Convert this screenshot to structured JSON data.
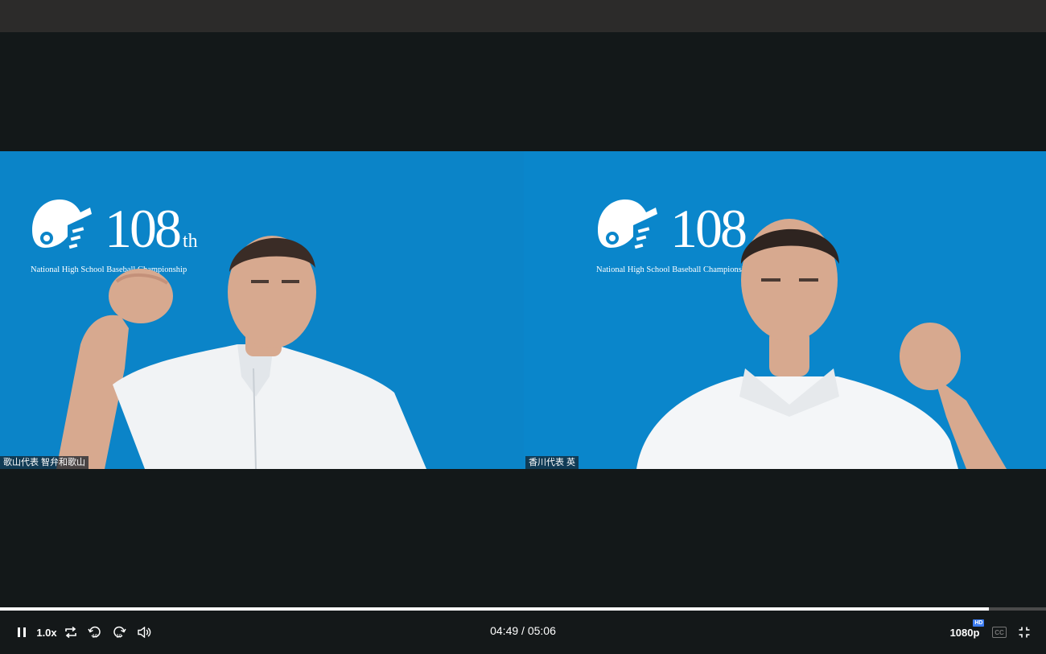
{
  "video": {
    "logo_number": "108",
    "logo_suffix": "th",
    "logo_subtitle": "National High School Baseball Championship",
    "left_name_tag": "歌山代表 智弁和歌山",
    "right_name_tag": "香川代表 英"
  },
  "player": {
    "progress_fraction": 0.945,
    "speed_label": "1.0x",
    "current_time": "04:49",
    "time_separator": "/",
    "duration": "05:06",
    "quality_label": "1080p",
    "hd_badge": "HD",
    "cc_label": "CC",
    "icons": {
      "play_pause": "pause-icon",
      "loop": "loop-icon",
      "rewind": "rewind-10-icon",
      "forward": "forward-10-icon",
      "volume": "volume-icon",
      "captions": "captions-icon",
      "fullscreen": "exit-fullscreen-icon"
    },
    "colors": {
      "accent": "#3d7df2",
      "progress_fill": "#ffffff",
      "bar_bg": "#141819"
    }
  }
}
